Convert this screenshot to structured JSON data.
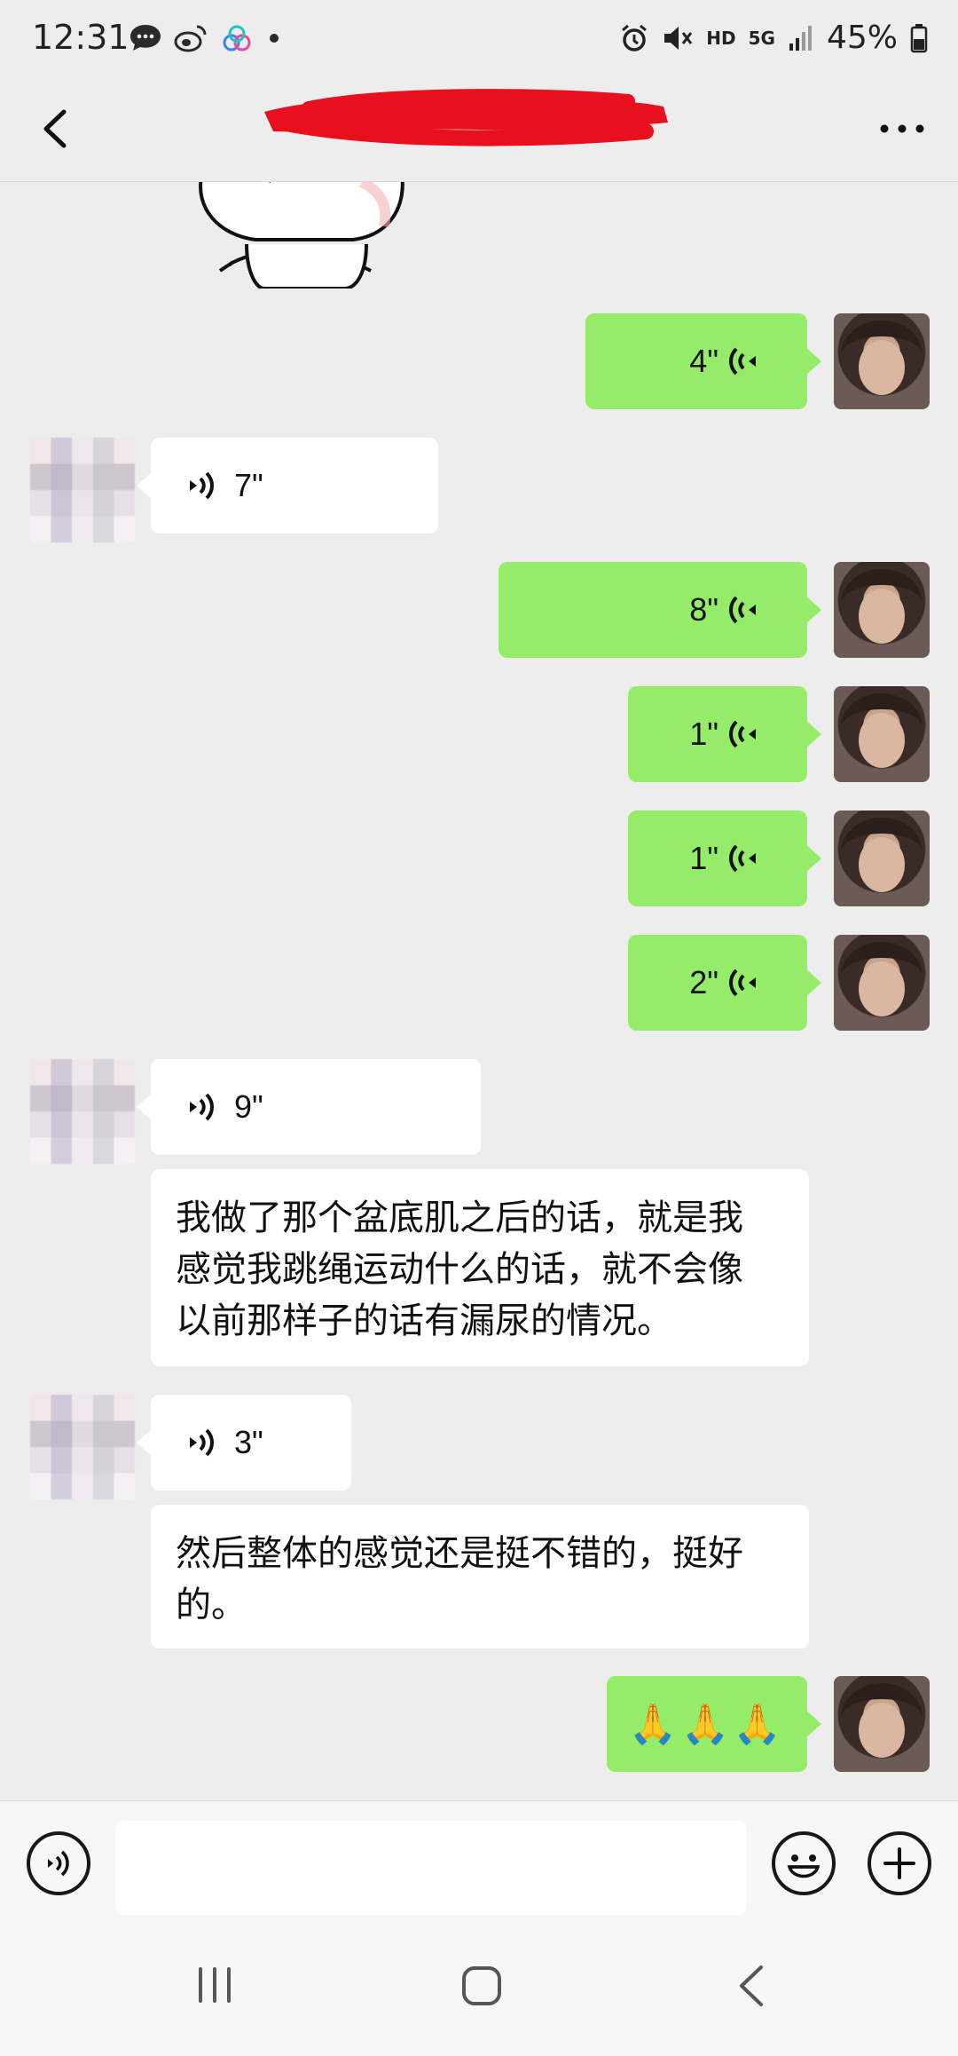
{
  "status_bar": {
    "time": "12:31",
    "battery": "45%",
    "network": "5G",
    "hd": "HD",
    "left_icons": [
      "chat-bubble-icon",
      "weibo-icon",
      "cloud-app-icon",
      "dot-icon"
    ],
    "right_icons": [
      "alarm-icon",
      "mute-icon",
      "hd-icon",
      "5g-icon",
      "signal-icon",
      "battery-icon"
    ]
  },
  "header": {
    "title": "",
    "back_icon": "chevron-left-icon",
    "more_icon": "more-dots-icon"
  },
  "messages": [
    {
      "side": "out",
      "kind": "voice",
      "duration": "4\""
    },
    {
      "side": "in",
      "kind": "voice",
      "duration": "7\""
    },
    {
      "side": "out",
      "kind": "voice",
      "duration": "8\""
    },
    {
      "side": "out",
      "kind": "voice",
      "duration": "1\""
    },
    {
      "side": "out",
      "kind": "voice",
      "duration": "1\""
    },
    {
      "side": "out",
      "kind": "voice",
      "duration": "2\""
    },
    {
      "side": "in",
      "kind": "voice",
      "duration": "9\""
    },
    {
      "side": "in",
      "kind": "text",
      "lines": [
        "我做了那个盆底肌之后的话，就是我",
        "感觉我跳绳运动什么的话，就不会像",
        "以前那样子的话有漏尿的情况。"
      ]
    },
    {
      "side": "in",
      "kind": "voice",
      "duration": "3\""
    },
    {
      "side": "in",
      "kind": "text",
      "lines": [
        "然后整体的感觉还是挺不错的，挺好",
        "的。"
      ]
    },
    {
      "side": "out",
      "kind": "emoji",
      "text": "🙏🙏🙏"
    }
  ],
  "input_bar": {
    "voice_icon": "voice-mode-icon",
    "emoji_icon": "smiley-icon",
    "plus_icon": "plus-icon",
    "value": ""
  },
  "nav_bar": {
    "icons": [
      "recent-apps-icon",
      "home-icon",
      "back-icon"
    ]
  },
  "colors": {
    "outgoing_bubble": "#95ec69",
    "incoming_bubble": "#ffffff",
    "background": "#ededed",
    "redaction": "#e8101c"
  }
}
